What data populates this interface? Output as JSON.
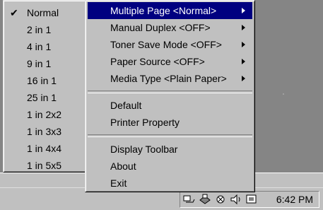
{
  "submenu": {
    "items": [
      {
        "label": "Normal",
        "checked": true
      },
      {
        "label": "2 in 1"
      },
      {
        "label": "4 in 1"
      },
      {
        "label": "9 in 1"
      },
      {
        "label": "16 in 1"
      },
      {
        "label": "25 in 1"
      },
      {
        "label": "1 in 2x2"
      },
      {
        "label": "1 in 3x3"
      },
      {
        "label": "1 in 4x4"
      },
      {
        "label": "1 in 5x5"
      }
    ],
    "check_glyph": "✔"
  },
  "menu": {
    "items": [
      {
        "label": "Multiple Page <Normal>",
        "highlighted": true,
        "has_submenu": true
      },
      {
        "label": "Manual Duplex <OFF>",
        "has_submenu": true
      },
      {
        "label": "Toner Save Mode <OFF>",
        "has_submenu": true
      },
      {
        "label": "Paper Source <OFF>",
        "has_submenu": true
      },
      {
        "label": "Media Type <Plain Paper>",
        "has_submenu": true
      },
      {
        "label": "Default"
      },
      {
        "label": "Printer Property"
      },
      {
        "label": "Display Toolbar"
      },
      {
        "label": "About"
      },
      {
        "label": "Exit"
      }
    ]
  },
  "taskbar": {
    "clock": "6:42 PM",
    "tray_icons": [
      "network-icon",
      "printer-icon",
      "security-icon",
      "volume-icon",
      "printer-monitor-icon"
    ]
  },
  "colors": {
    "highlight": "#000080",
    "desktop": "#858585",
    "face": "#c0c0c0"
  }
}
